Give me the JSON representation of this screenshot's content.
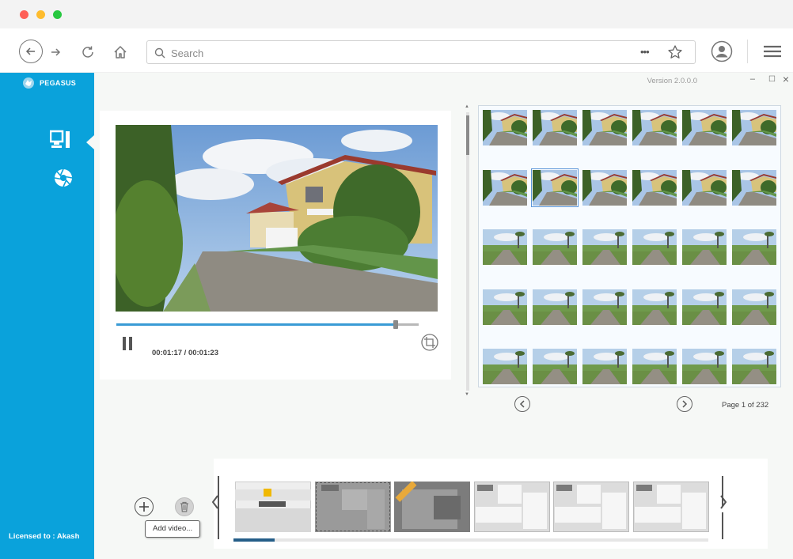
{
  "browser": {
    "search_placeholder": "Search",
    "overflow_label": "•••"
  },
  "app": {
    "brand": "PEGASUS",
    "version": "Version 2.0.0.0",
    "licensed": "Licensed to : Akash",
    "sidebar_items": [
      {
        "icon": "monitor-icon",
        "active": true
      },
      {
        "icon": "shutter-icon",
        "active": false
      }
    ],
    "window_controls": {
      "minimize": "‒",
      "maximize": "☐",
      "close": "×"
    }
  },
  "player": {
    "state": "playing",
    "timecode": "00:01:17 / 00:01:23",
    "progress": 0.923
  },
  "gallery": {
    "page_label": "Page 1 of 232",
    "selected_index": 7
  },
  "timeline": {
    "tooltip": "Add video..."
  },
  "colors": {
    "accent": "#0aa2db",
    "progress": "#3a9bd5",
    "selection": "#5b95d8"
  }
}
